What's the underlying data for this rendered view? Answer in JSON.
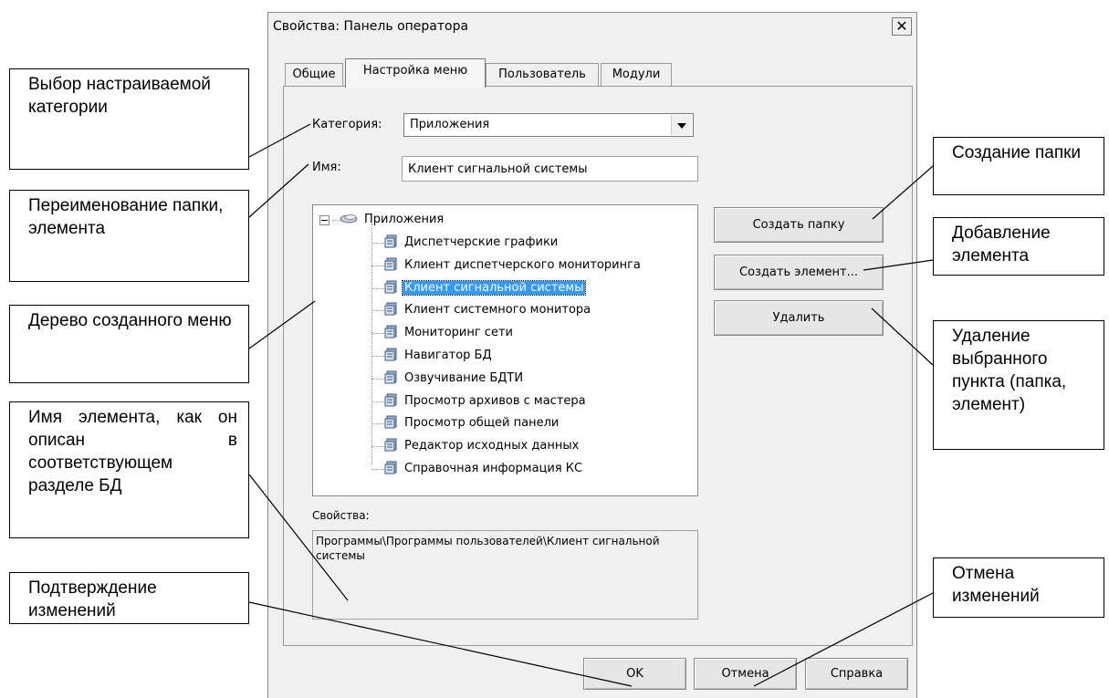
{
  "dialog": {
    "title": "Свойства: Панель оператора",
    "close_label": "✕",
    "tabs": [
      {
        "label": "Общие",
        "active": false
      },
      {
        "label": "Настройка меню",
        "active": true
      },
      {
        "label": "Пользователь",
        "active": false
      },
      {
        "label": "Модули",
        "active": false
      }
    ],
    "category_label": "Категория:",
    "category_value": "Приложения",
    "name_label": "Имя:",
    "name_value": "Клиент сигнальной системы",
    "tree": {
      "root": "Приложения",
      "items": [
        "Диспетчерские графики",
        "Клиент диспетчерского мониторинга",
        "Клиент сигнальной системы",
        "Клиент системного монитора",
        "Мониторинг сети",
        "Навигатор БД",
        "Озвучивание БДТИ",
        "Просмотр архивов с мастера",
        "Просмотр общей панели",
        "Редактор исходных данных",
        "Справочная информация КС"
      ],
      "selected_item": "Клиент сигнальной системы"
    },
    "properties_label": "Свойства:",
    "properties_value": "Программы\\Программы пользователей\\Клиент сигнальной системы",
    "buttons": {
      "create_folder": "Создать папку",
      "create_item": "Создать элемент...",
      "delete": "Удалить",
      "ok": "OK",
      "cancel": "Отмена",
      "help": "Справка"
    }
  },
  "annotations": {
    "category": "Выбор настраиваемой категории",
    "rename": "Переименование папки, элемента",
    "tree": "Дерево созданного меню",
    "element_name": "Имя элемента, как он описан в соответствующем разделе БД",
    "confirm": "Подтверждение изменений",
    "create_folder": "Создание папки",
    "add_element": "Добавление элемента",
    "delete": "Удаление выбранного пункта (папка, элемент)",
    "cancel": "Отмена изменений"
  },
  "colors": {
    "selection": "#3399ff",
    "dialog_bg": "#f0f0f0"
  }
}
